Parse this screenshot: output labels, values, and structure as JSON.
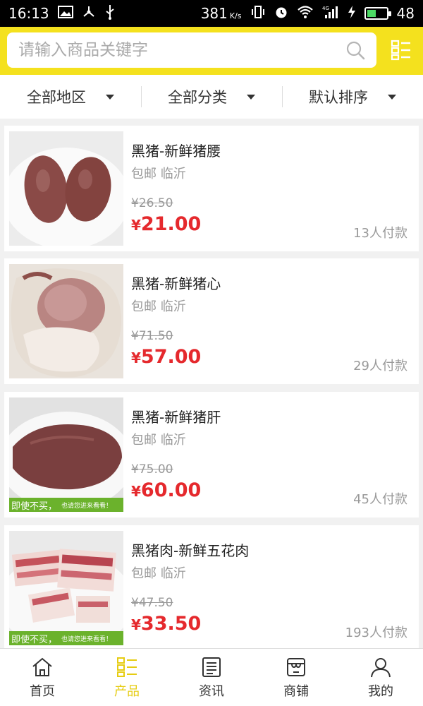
{
  "status_bar": {
    "time": "16:13",
    "speed": "381",
    "speed_unit": "K/s",
    "network": "4G",
    "battery": "48",
    "battery_level": 0.48
  },
  "search": {
    "placeholder": "请输入商品关键字"
  },
  "filters": [
    {
      "label": "全部地区"
    },
    {
      "label": "全部分类"
    },
    {
      "label": "默认排序"
    }
  ],
  "products": [
    {
      "title": "黑猪-新鲜猪腰",
      "subtitle": "包邮 临沂",
      "old_price": "¥26.50",
      "currency": "¥",
      "price": "21.00",
      "paid": "13人付款",
      "image": "pork-kidney"
    },
    {
      "title": "黑猪-新鲜猪心",
      "subtitle": "包邮 临沂",
      "old_price": "¥71.50",
      "currency": "¥",
      "price": "57.00",
      "paid": "29人付款",
      "image": "pork-heart"
    },
    {
      "title": "黑猪-新鲜猪肝",
      "subtitle": "包邮 临沂",
      "old_price": "¥75.00",
      "currency": "¥",
      "price": "60.00",
      "paid": "45人付款",
      "image": "pork-liver",
      "banner": "即使不买，",
      "banner_small": "也请您进来看看！"
    },
    {
      "title": "黑猪肉-新鲜五花肉",
      "subtitle": "包邮 临沂",
      "old_price": "¥47.50",
      "currency": "¥",
      "price": "33.50",
      "paid": "193人付款",
      "image": "pork-belly",
      "banner": "即使不买，",
      "banner_small": "也请您进来看看！"
    }
  ],
  "tabs": [
    {
      "label": "首页",
      "icon": "home-icon"
    },
    {
      "label": "产品",
      "icon": "list-icon",
      "active": true
    },
    {
      "label": "资讯",
      "icon": "news-icon"
    },
    {
      "label": "商铺",
      "icon": "shop-icon"
    },
    {
      "label": "我的",
      "icon": "user-icon"
    }
  ],
  "colors": {
    "header_yellow": "#f4e11e",
    "price_red": "#e5292d",
    "active_tab": "#e6cc12",
    "banner_green": "#6bb22c"
  }
}
